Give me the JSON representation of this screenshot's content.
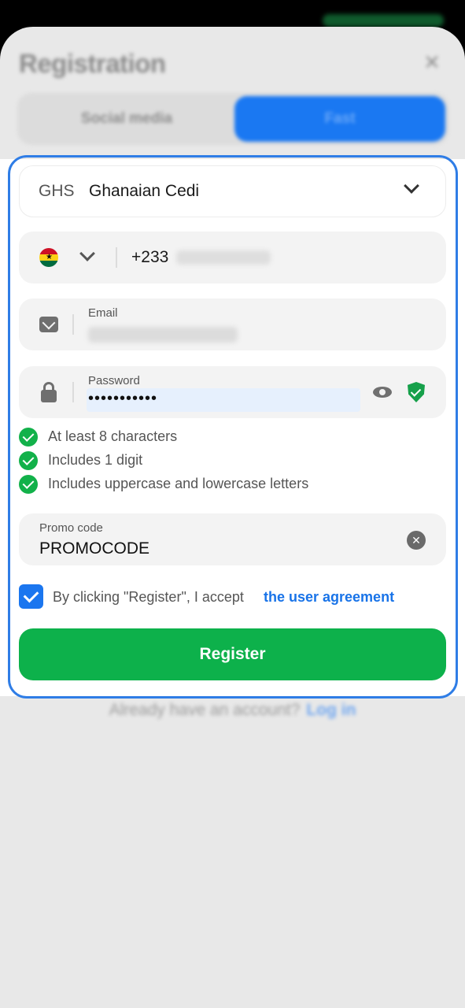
{
  "header": {
    "title": "Registration"
  },
  "tabs": [
    {
      "label": "Social media",
      "active": false
    },
    {
      "label": "Fast",
      "active": true
    }
  ],
  "currency": {
    "code": "GHS",
    "name": "Ghanaian Cedi"
  },
  "phone": {
    "prefix": "+233",
    "country_flag": "ghana-flag-icon"
  },
  "email": {
    "label": "Email"
  },
  "password": {
    "label": "Password",
    "masked_value": "•••••••••••"
  },
  "password_rules": [
    "At least 8 characters",
    "Includes 1 digit",
    "Includes uppercase and lowercase letters"
  ],
  "promo": {
    "label": "Promo code",
    "value": "PROMOCODE"
  },
  "agreement": {
    "checked": true,
    "text": "By clicking \"Register\", I accept",
    "link": "the user agreement"
  },
  "register_label": "Register",
  "footer": {
    "text": "Already have an account?",
    "link": "Log in"
  },
  "colors": {
    "accent_blue": "#1b76ef",
    "success_green": "#0db14b",
    "highlight_border": "#2f7de6"
  }
}
